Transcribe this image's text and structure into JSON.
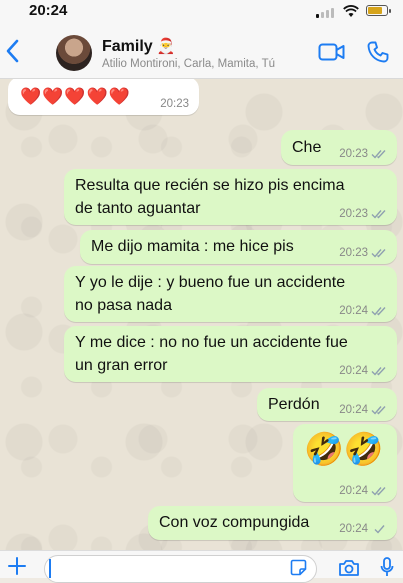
{
  "status_bar": {
    "time": "20:24"
  },
  "header": {
    "title": "Family",
    "title_emoji": "🎅",
    "subtitle": "Atilio Montironi, Carla, Mamita, Tú"
  },
  "messages": [
    {
      "direction": "in",
      "text": "❤️❤️❤️❤️❤️",
      "time": "20:23"
    },
    {
      "direction": "out",
      "text": "Che",
      "time": "20:23"
    },
    {
      "direction": "out",
      "lines": [
        "Resulta que recién se hizo pis encima",
        "de tanto aguantar"
      ],
      "time": "20:23"
    },
    {
      "direction": "out",
      "text": "Me dijo mamita : me hice pis",
      "time": "20:23"
    },
    {
      "direction": "out",
      "lines": [
        "Y yo le dije : y bueno fue un accidente",
        "no pasa nada"
      ],
      "time": "20:24"
    },
    {
      "direction": "out",
      "lines": [
        "Y me dice : no no fue un accidente fue",
        "un gran error"
      ],
      "time": "20:24"
    },
    {
      "direction": "out",
      "text": "Perdón",
      "time": "20:24"
    },
    {
      "direction": "out",
      "text": "🤣🤣",
      "time": "20:24"
    },
    {
      "direction": "out",
      "text": "Con voz compungida",
      "time": "20:24"
    }
  ],
  "colors": {
    "accent": "#1d7cf2",
    "outgoing": "#dcf8c6",
    "incoming": "#ffffff"
  }
}
